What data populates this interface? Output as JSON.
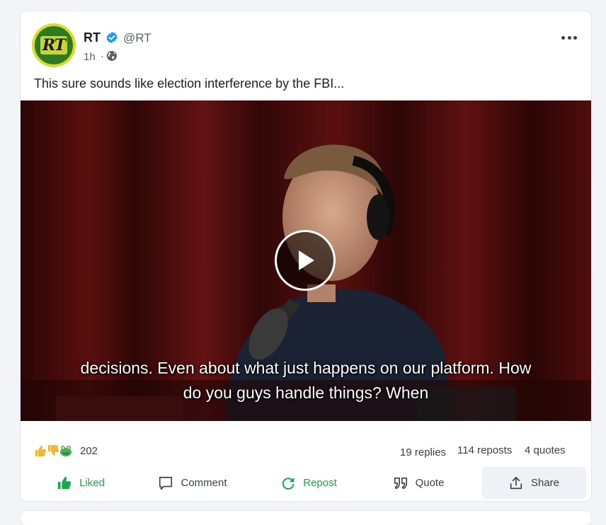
{
  "post": {
    "author": {
      "name": "RT",
      "handle": "@RT",
      "avatar_text": "RT",
      "verified": true
    },
    "time": "1h",
    "separator": "·",
    "visibility_icon": "globe-icon",
    "text": "This sure sounds like election interference by the FBI...",
    "video": {
      "caption_line1": "decisions. Even about what just happens on our platform. How",
      "caption_line2": "do you guys handle things? When"
    },
    "reactions": {
      "icons": [
        "thumbs-up-icon",
        "thumbs-down-icon",
        "frog-icon"
      ],
      "count": "202"
    },
    "stats": {
      "replies": "19 replies",
      "reposts": "114 reposts",
      "quotes": "4 quotes"
    },
    "actions": {
      "liked": "Liked",
      "comment": "Comment",
      "repost": "Repost",
      "quote": "Quote",
      "share": "Share"
    }
  },
  "colors": {
    "accent_green": "#18a84b",
    "verified_blue": "#1d9bf0",
    "text_primary": "#1c1e21",
    "text_secondary": "#5a5f66"
  }
}
